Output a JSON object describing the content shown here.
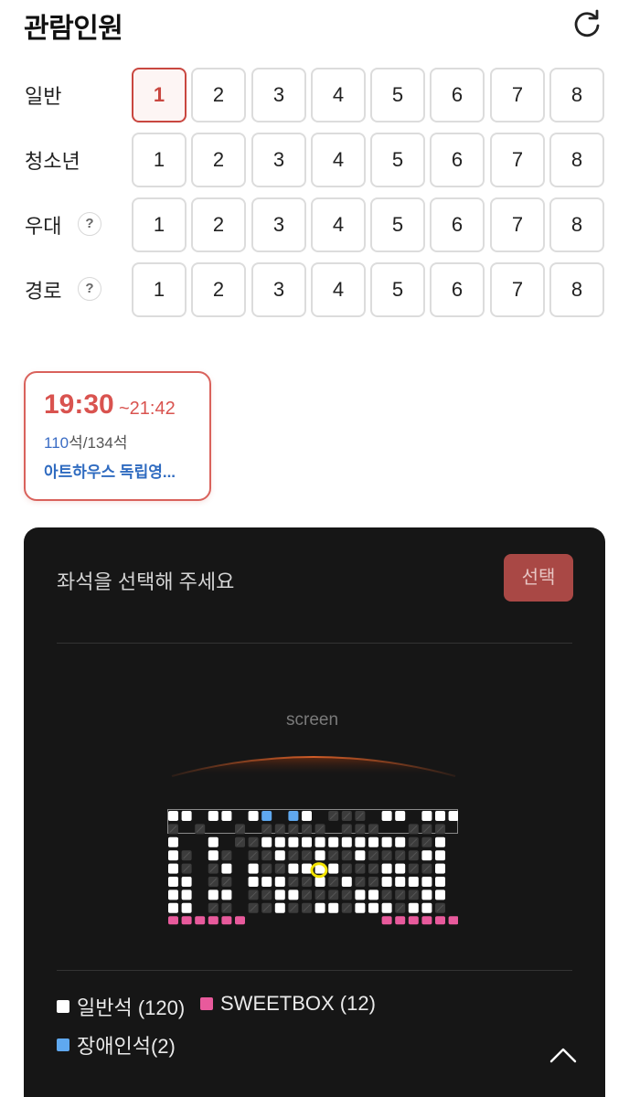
{
  "header": {
    "title": "관람인원",
    "refresh_icon": "refresh-icon"
  },
  "people": {
    "numbers": [
      "1",
      "2",
      "3",
      "4",
      "5",
      "6",
      "7",
      "8"
    ],
    "rows": [
      {
        "label": "일반",
        "help": false,
        "selected": "1"
      },
      {
        "label": "청소년",
        "help": false,
        "selected": null
      },
      {
        "label": "우대",
        "help": true,
        "selected": null
      },
      {
        "label": "경로",
        "help": true,
        "selected": null
      }
    ],
    "help_glyph": "?"
  },
  "showtime": {
    "start": "19:30",
    "end": "~21:42",
    "available": "110",
    "available_suffix": "석",
    "total": "/134석",
    "hall": "아트하우스 독립영..."
  },
  "seatpanel": {
    "prompt": "좌석을 선택해 주세요",
    "select_label": "선택",
    "screen_label": "screen",
    "legend": [
      {
        "label": "일반석 (120)",
        "color": "#ffffff"
      },
      {
        "label": "SWEETBOX (12)",
        "color": "#e85a9c"
      },
      {
        "label": "장애인석(2)",
        "color": "#5fa8ef"
      }
    ],
    "seat_colors": {
      "available": "#ffffff",
      "taken": "#3c3c3c",
      "sweetbox": "#e85a9c",
      "accessible": "#5fa8ef",
      "marker": "#f2e300"
    },
    "seat_rows": [
      "AA.AA.AB.BA.TTT.AA.AAA",
      "T.T..T.TTTTT.TTT..TTT",
      "A..A.TTAAAAAAAAAAATTA",
      "AT.AT.TTATTATTATTTTAA",
      "AT.TA.ATTAAAATTTAATTA",
      "AA.TT.AAATTATATTAAAAA",
      "AA.AA.TTAATTTTAATTTAA",
      "AA.TT.TTATTAATAAATAAT",
      "SSSSSS..........SSSSSS"
    ]
  }
}
